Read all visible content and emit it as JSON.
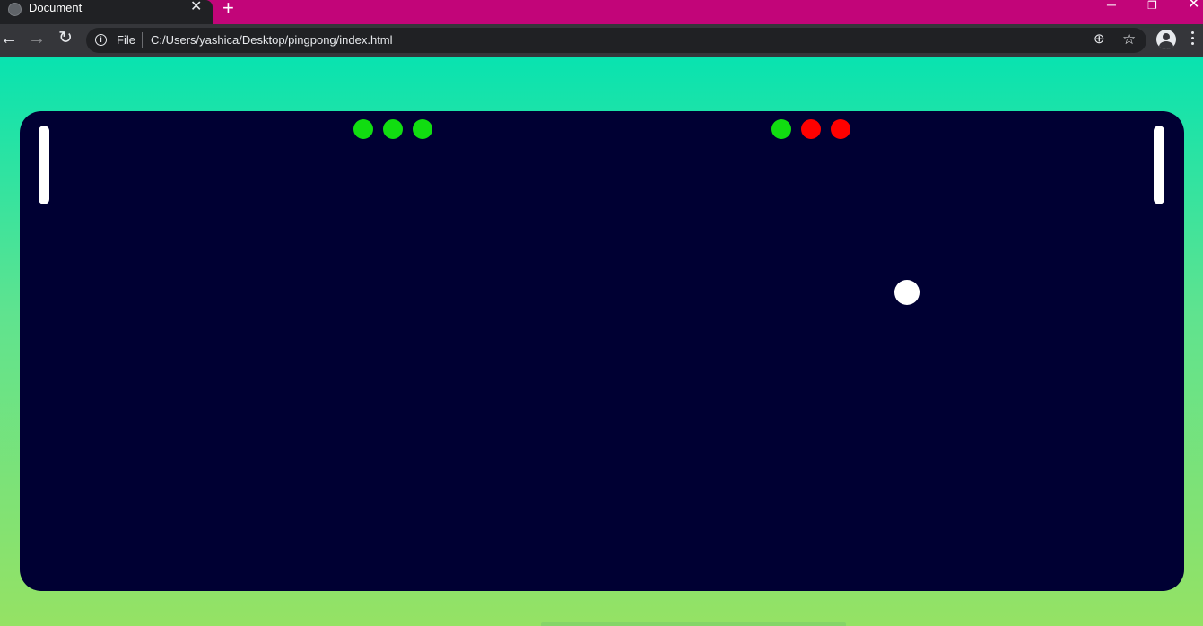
{
  "browser": {
    "tab": {
      "title": "Document",
      "close_glyph": "✕",
      "icon": "globe-icon"
    },
    "new_tab_glyph": "+",
    "window_controls": {
      "minimize": "─",
      "maximize": "❐",
      "close": "✕"
    },
    "toolbar": {
      "back_glyph": "←",
      "forward_glyph": "→",
      "reload_glyph": "↻",
      "address": {
        "info_glyph": "i",
        "scheme_label": "File",
        "url": "C:/Users/yashica/Desktop/pingpong/index.html"
      },
      "zoom_glyph": "⊕",
      "star_glyph": "☆"
    },
    "colors": {
      "titlebar": "#c20579",
      "toolbar": "#35363a"
    }
  },
  "game": {
    "board_color": "#000033",
    "paddle_color": "#ffffff",
    "ball_color": "#ffffff",
    "left_lives": [
      "#11dd11",
      "#11dd11",
      "#11dd11"
    ],
    "right_lives": [
      "#11dd11",
      "#ff0000",
      "#ff0000"
    ]
  }
}
